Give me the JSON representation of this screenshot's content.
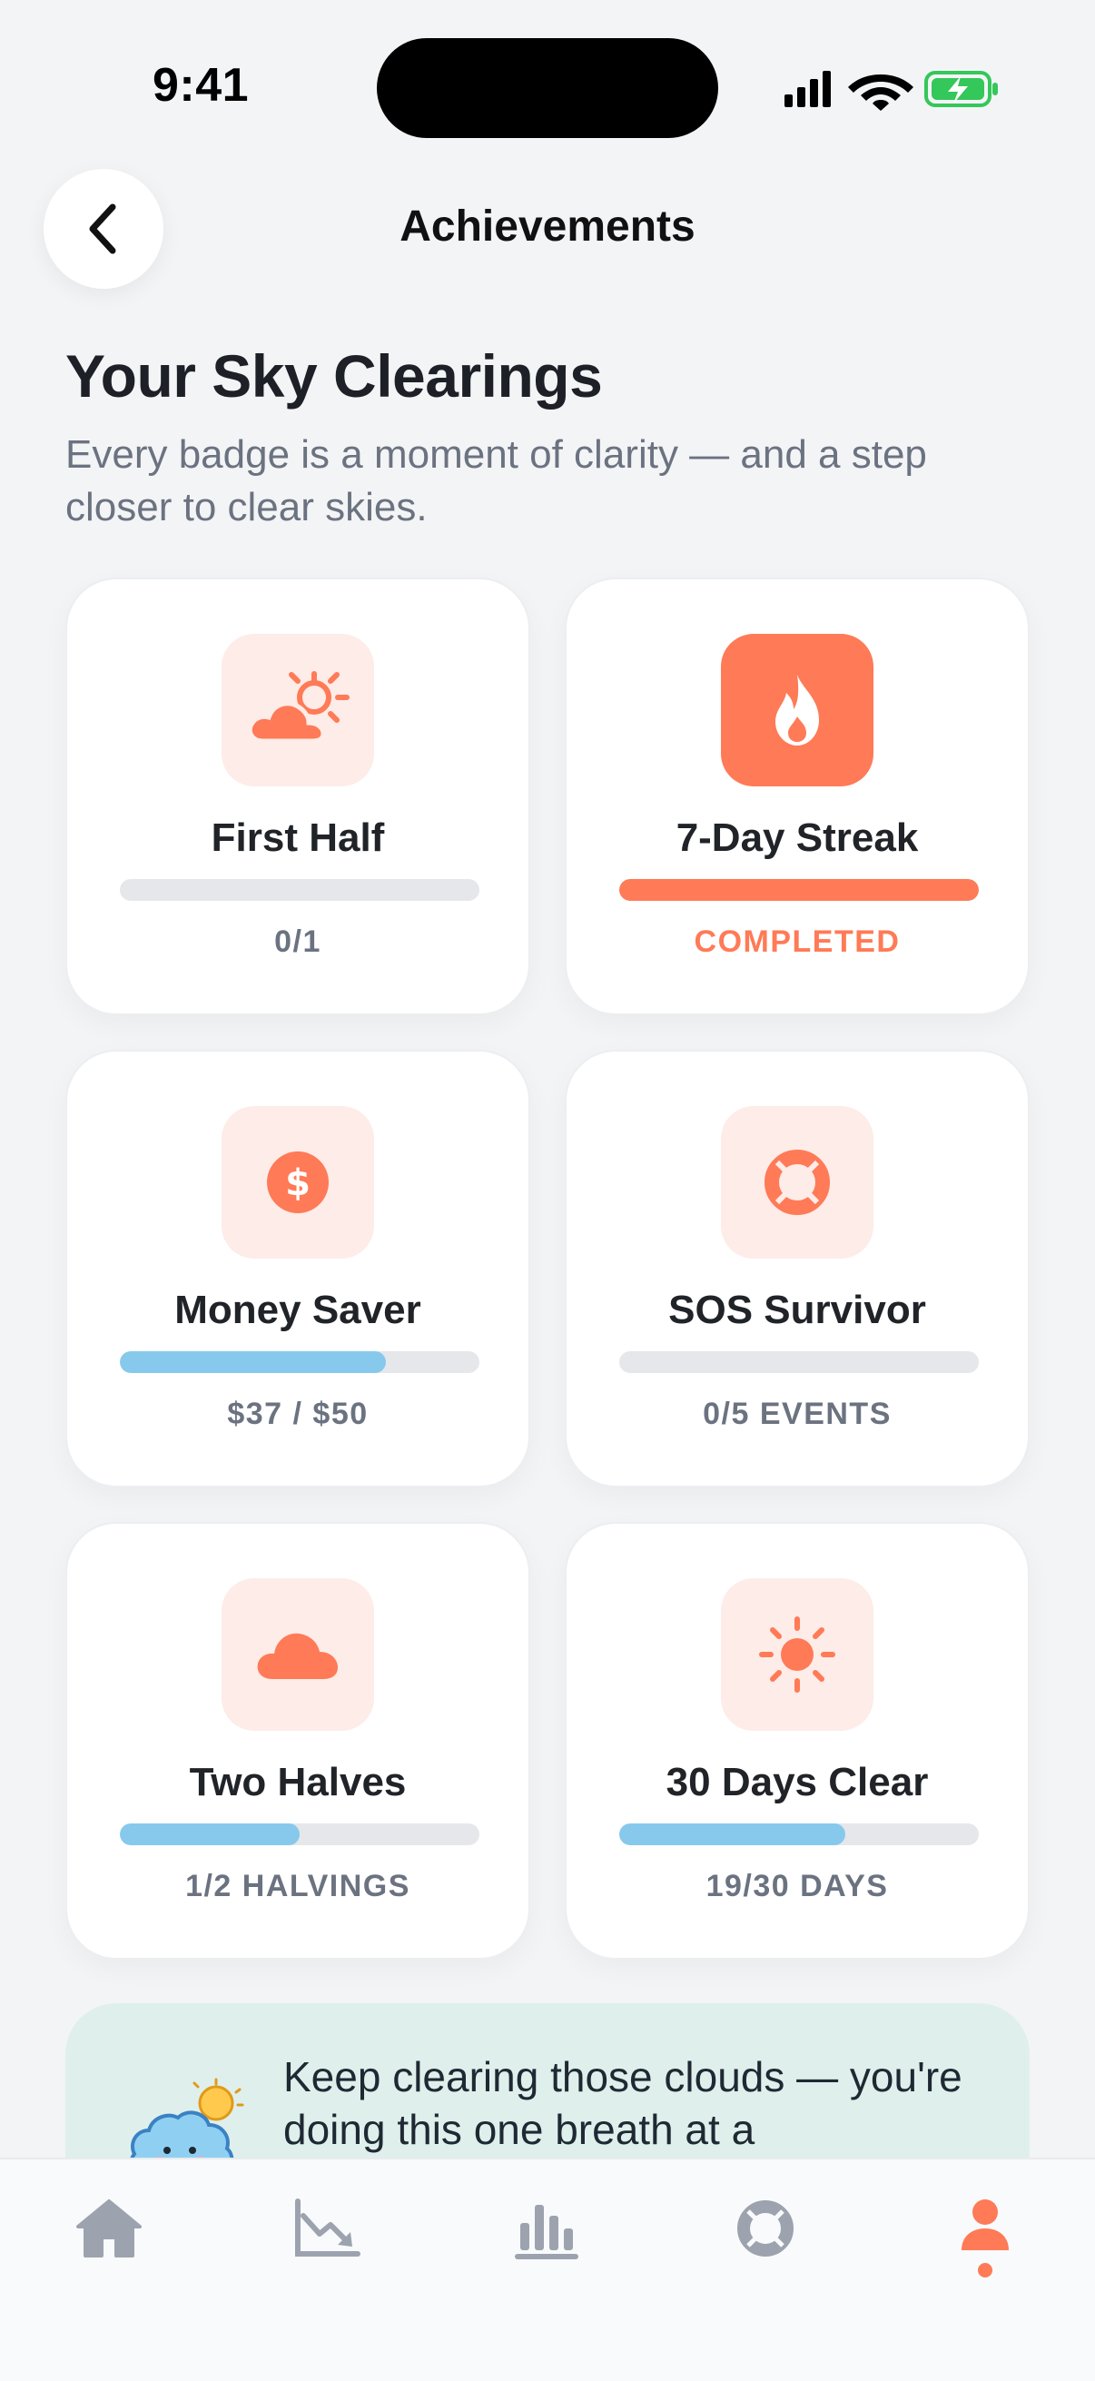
{
  "status_bar": {
    "time": "9:41"
  },
  "header": {
    "title": "Achievements",
    "back_icon": "chevron-left-icon"
  },
  "intro": {
    "title": "Your Sky Clearings",
    "subtitle": "Every badge is a moment of clarity — and a step closer to clear skies."
  },
  "badges": [
    {
      "name": "First Half",
      "icon": "sun-behind-cloud-icon",
      "progress": 0.0,
      "label": "0/1",
      "completed": false
    },
    {
      "name": "7-Day Streak",
      "icon": "flame-icon",
      "progress": 1.0,
      "label": "COMPLETED",
      "completed": true
    },
    {
      "name": "Money Saver",
      "icon": "dollar-coin-icon",
      "progress": 0.74,
      "label": "$37 / $50",
      "completed": false
    },
    {
      "name": "SOS Survivor",
      "icon": "lifebuoy-icon",
      "progress": 0.0,
      "label": "0/5 EVENTS",
      "completed": false
    },
    {
      "name": "Two Halves",
      "icon": "cloud-icon",
      "progress": 0.5,
      "label": "1/2 HALVINGS",
      "completed": false
    },
    {
      "name": "30 Days Clear",
      "icon": "sun-icon",
      "progress": 0.63,
      "label": "19/30 DAYS",
      "completed": false
    }
  ],
  "encouragement": {
    "text": "Keep clearing those clouds — you're doing this one breath at a",
    "icon": "cloud-mascot-icon"
  },
  "tab_bar": {
    "tabs": [
      {
        "icon": "home-icon",
        "active": false
      },
      {
        "icon": "trend-down-chart-icon",
        "active": false
      },
      {
        "icon": "bar-chart-icon",
        "active": false
      },
      {
        "icon": "lifebuoy-icon",
        "active": false
      },
      {
        "icon": "profile-icon",
        "active": true
      }
    ]
  },
  "colors": {
    "accent": "#ff7a56",
    "progress": "#87c9ec",
    "track": "#e5e7eb",
    "tint": "#fdece8",
    "banner": "#dff0ec",
    "inactive_tab": "#9ca3af"
  }
}
